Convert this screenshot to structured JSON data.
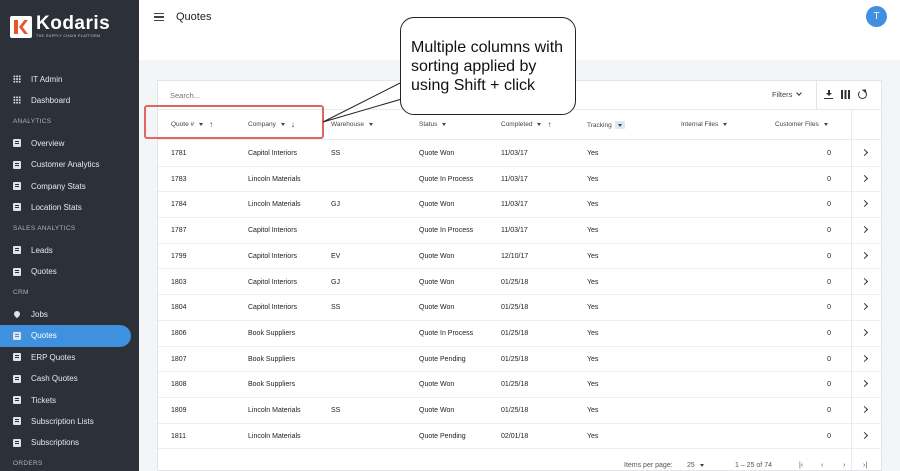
{
  "brand": {
    "name": "Kodaris",
    "tagline": "THE SUPPLY CHAIN PLATFORM"
  },
  "sidebar": {
    "items": [
      {
        "label": "IT Admin",
        "icon": "grid-icon"
      },
      {
        "label": "Dashboard",
        "icon": "grid-icon"
      }
    ],
    "sections": [
      {
        "title": "ANALYTICS",
        "items": [
          {
            "label": "Overview",
            "icon": "chart-icon"
          },
          {
            "label": "Customer Analytics",
            "icon": "chart-icon"
          },
          {
            "label": "Company Stats",
            "icon": "chart-icon"
          },
          {
            "label": "Location Stats",
            "icon": "chart-icon"
          }
        ]
      },
      {
        "title": "SALES ANALYTICS",
        "items": [
          {
            "label": "Leads",
            "icon": "chart-icon"
          },
          {
            "label": "Quotes",
            "icon": "chart-icon"
          }
        ]
      },
      {
        "title": "CRM",
        "items": [
          {
            "label": "Jobs",
            "icon": "pin-icon"
          },
          {
            "label": "Quotes",
            "icon": "document-icon",
            "active": true
          },
          {
            "label": "ERP Quotes",
            "icon": "document-icon"
          },
          {
            "label": "Cash Quotes",
            "icon": "document-icon"
          },
          {
            "label": "Tickets",
            "icon": "ticket-icon"
          },
          {
            "label": "Subscription Lists",
            "icon": "list-icon"
          },
          {
            "label": "Subscriptions",
            "icon": "list-icon"
          }
        ]
      },
      {
        "title": "ORDERS",
        "items": []
      }
    ]
  },
  "header": {
    "title": "Quotes",
    "avatar_initial": "T"
  },
  "toolbar": {
    "search_placeholder": "Search...",
    "filters_label": "Filters"
  },
  "table": {
    "columns": [
      {
        "label": "Quote #",
        "sort": "asc"
      },
      {
        "label": "Company",
        "sort": "desc"
      },
      {
        "label": "Warehouse",
        "sort": ""
      },
      {
        "label": "Status",
        "sort": ""
      },
      {
        "label": "Completed",
        "sort": "asc"
      },
      {
        "label": "Tracking",
        "sort": "",
        "filter_active": true
      },
      {
        "label": "Internal Files",
        "sort": ""
      },
      {
        "label": "Customer Files",
        "sort": ""
      }
    ],
    "rows": [
      {
        "quote": "1781",
        "company": "Capitol Interiors",
        "warehouse": "SS",
        "status": "Quote Won",
        "completed": "11/03/17",
        "tracking": "Yes",
        "internal_files": "",
        "customer_files": "0"
      },
      {
        "quote": "1783",
        "company": "Lincoln Materials",
        "warehouse": "",
        "status": "Quote In Process",
        "completed": "11/03/17",
        "tracking": "Yes",
        "internal_files": "",
        "customer_files": "0"
      },
      {
        "quote": "1784",
        "company": "Lincoln Materials",
        "warehouse": "GJ",
        "status": "Quote Won",
        "completed": "11/03/17",
        "tracking": "Yes",
        "internal_files": "",
        "customer_files": "0"
      },
      {
        "quote": "1787",
        "company": "Capitol Interiors",
        "warehouse": "",
        "status": "Quote In Process",
        "completed": "11/03/17",
        "tracking": "Yes",
        "internal_files": "",
        "customer_files": "0"
      },
      {
        "quote": "1799",
        "company": "Capitol Interiors",
        "warehouse": "EV",
        "status": "Quote Won",
        "completed": "12/10/17",
        "tracking": "Yes",
        "internal_files": "",
        "customer_files": "0"
      },
      {
        "quote": "1803",
        "company": "Capitol Interiors",
        "warehouse": "GJ",
        "status": "Quote Won",
        "completed": "01/25/18",
        "tracking": "Yes",
        "internal_files": "",
        "customer_files": "0"
      },
      {
        "quote": "1804",
        "company": "Capitol Interiors",
        "warehouse": "SS",
        "status": "Quote Won",
        "completed": "01/25/18",
        "tracking": "Yes",
        "internal_files": "",
        "customer_files": "0"
      },
      {
        "quote": "1806",
        "company": "Book Suppliers",
        "warehouse": "",
        "status": "Quote In Process",
        "completed": "01/25/18",
        "tracking": "Yes",
        "internal_files": "",
        "customer_files": "0"
      },
      {
        "quote": "1807",
        "company": "Book Suppliers",
        "warehouse": "",
        "status": "Quote Pending",
        "completed": "01/25/18",
        "tracking": "Yes",
        "internal_files": "",
        "customer_files": "0"
      },
      {
        "quote": "1808",
        "company": "Book Suppliers",
        "warehouse": "",
        "status": "Quote Won",
        "completed": "01/25/18",
        "tracking": "Yes",
        "internal_files": "",
        "customer_files": "0"
      },
      {
        "quote": "1809",
        "company": "Lincoln Materials",
        "warehouse": "SS",
        "status": "Quote Won",
        "completed": "01/25/18",
        "tracking": "Yes",
        "internal_files": "",
        "customer_files": "0"
      },
      {
        "quote": "1811",
        "company": "Lincoln Materials",
        "warehouse": "",
        "status": "Quote Pending",
        "completed": "02/01/18",
        "tracking": "Yes",
        "internal_files": "",
        "customer_files": "0"
      }
    ]
  },
  "pagination": {
    "items_per_page_label": "Items per page:",
    "items_per_page": "25",
    "range": "1 – 25 of 74"
  },
  "annotation": {
    "text": "Multiple columns with sorting applied by using Shift + click",
    "highlight_color": "#e06666"
  }
}
